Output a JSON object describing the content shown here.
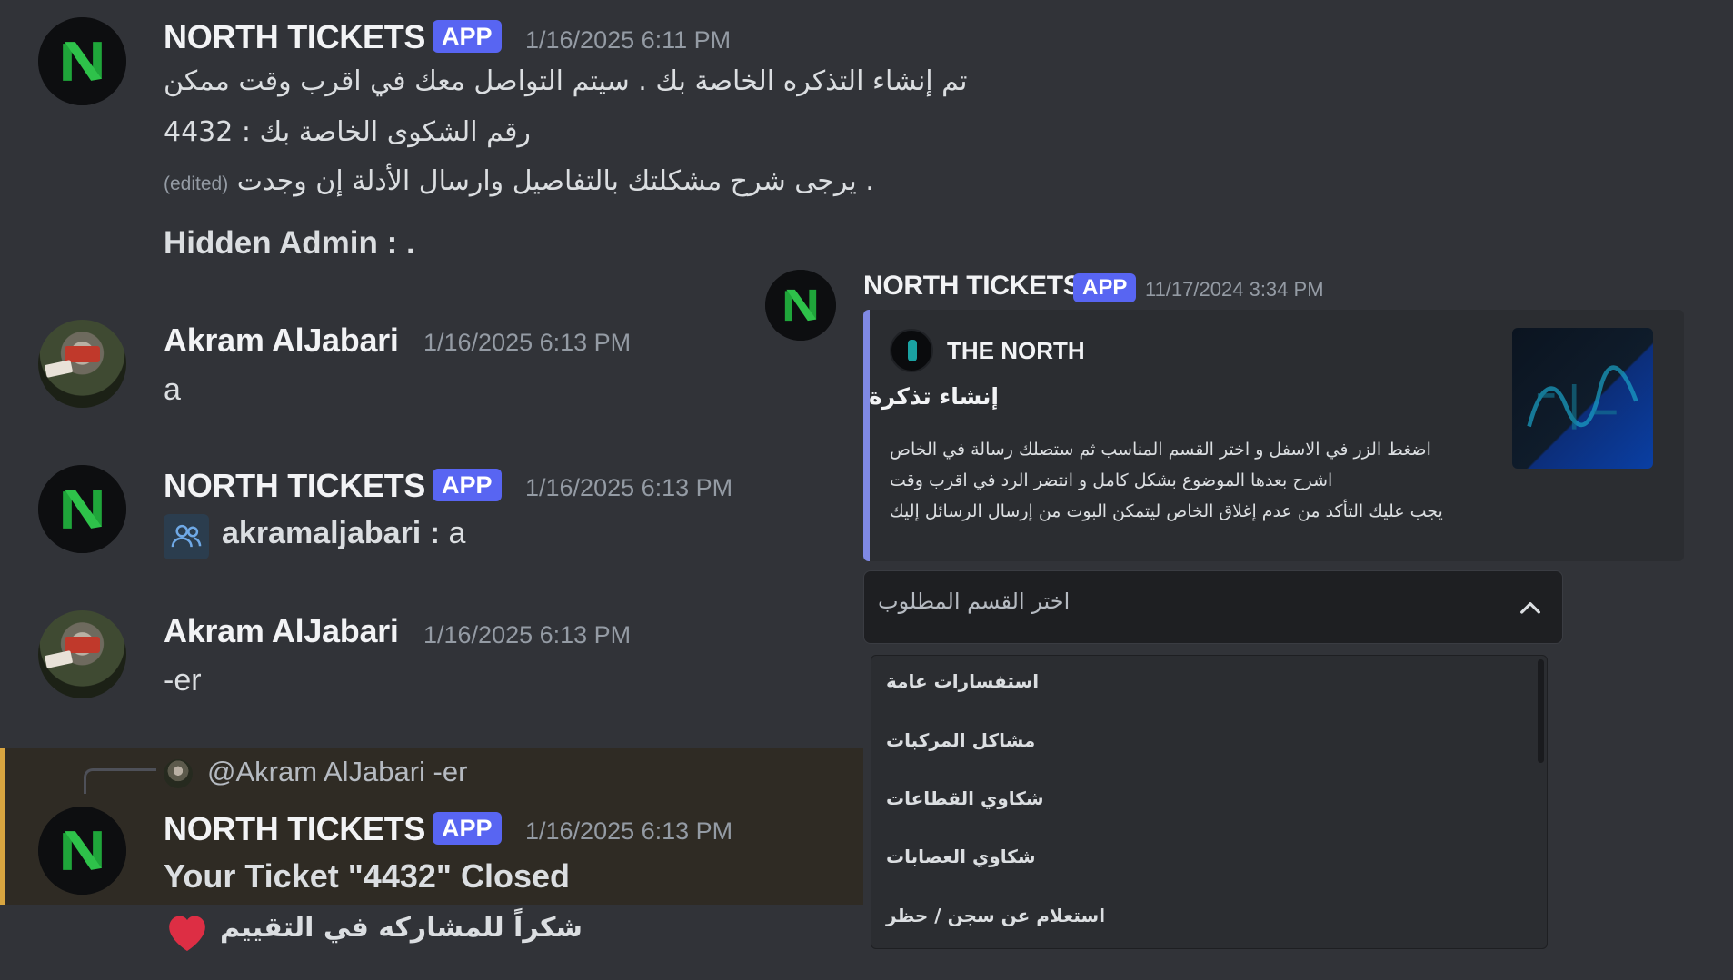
{
  "colors": {
    "background": "#313338",
    "app_badge": "#5865f2",
    "highlight_bar": "#d8a540",
    "embed_bar": "#7f89e4",
    "bot_logo_green": "#1fa53a"
  },
  "messages": [
    {
      "author": "NORTH TICKETS",
      "badge": "APP",
      "timestamp": "1/16/2025 6:11 PM",
      "lines": [
        "تم إنشاء التذكره الخاصة بك . سيتم التواصل معك في اقرب وقت ممكن",
        "رقم الشكوى الخاصة بك : 4432",
        "يرجى شرح مشكلتك بالتفاصيل وارسال الأدلة إن وجدت ."
      ],
      "edited": "(edited)",
      "hidden_admin": "Hidden Admin : ."
    },
    {
      "author": "Akram AlJabari",
      "timestamp": "1/16/2025 6:13 PM",
      "text": "a"
    },
    {
      "author": "NORTH TICKETS",
      "badge": "APP",
      "timestamp": "1/16/2025 6:13 PM",
      "mention_icon": "users-icon",
      "mention_name": "akramaljabari",
      "mention_text": ": a"
    },
    {
      "author": "Akram AlJabari",
      "timestamp": "1/16/2025 6:13 PM",
      "text": "-er"
    },
    {
      "reply_to": "@Akram AlJabari -er",
      "author": "NORTH TICKETS",
      "badge": "APP",
      "timestamp": "1/16/2025 6:13 PM",
      "title": "Your Ticket \"4432\" Closed",
      "footer": "شكراً للمشاركه في التقييم",
      "footer_icon": "heart-icon"
    }
  ],
  "panel": {
    "author": "NORTH TICKETS",
    "badge": "APP",
    "timestamp": "11/17/2024 3:34 PM",
    "embed": {
      "author": "THE NORTH",
      "title": "إنشاء تذكرة",
      "description": [
        "اضغط الزر في الاسفل و اختر القسم المناسب ثم ستصلك رسالة في الخاص",
        "اشرح بعدها الموضوع بشكل كامل و انتضر الرد في اقرب وقت",
        "يجب عليك التأكد من عدم إغلاق الخاص ليتمكن البوت من إرسال الرسائل إليك"
      ]
    },
    "select": {
      "placeholder": "اختر القسم المطلوب",
      "options": [
        "استفسارات عامة",
        "مشاكل المركبات",
        "شكاوي القطاعات",
        "شكاوي العصابات",
        "استعلام عن سجن / حظر"
      ]
    }
  }
}
